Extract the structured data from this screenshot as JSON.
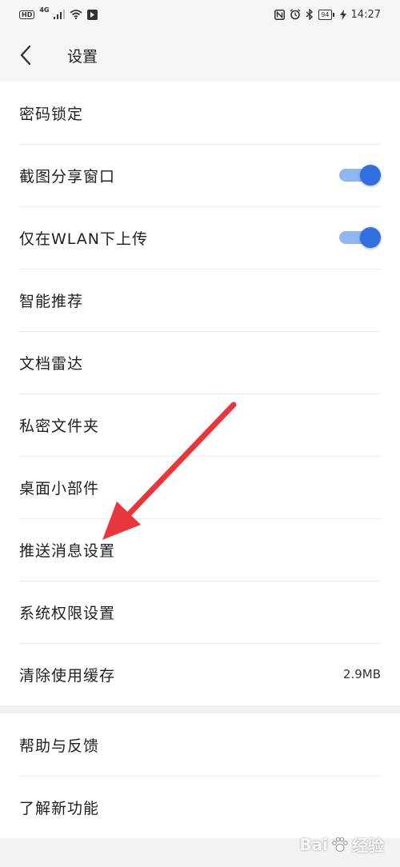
{
  "status_bar": {
    "hd_label": "HD",
    "network_label": "4G",
    "battery_level": "94",
    "time": "14:27"
  },
  "header": {
    "title": "设置",
    "back_icon": "chevron-left-icon"
  },
  "settings": {
    "group1": [
      {
        "label": "密码锁定"
      },
      {
        "label": "截图分享窗口",
        "toggle": true
      },
      {
        "label": "仅在WLAN下上传",
        "toggle": true
      },
      {
        "label": "智能推荐"
      },
      {
        "label": "文档雷达"
      },
      {
        "label": "私密文件夹"
      },
      {
        "label": "桌面小部件"
      },
      {
        "label": "推送消息设置"
      },
      {
        "label": "系统权限设置"
      },
      {
        "label": "清除使用缓存",
        "value": "2.9MB"
      }
    ],
    "group2": [
      {
        "label": "帮助与反馈"
      },
      {
        "label": "了解新功能"
      }
    ]
  },
  "colors": {
    "toggle_on": "#2f6fe0",
    "toggle_track": "#8fb6f0",
    "arrow": "#e8363a"
  },
  "watermark": {
    "brand": "Bai",
    "suffix": "经验"
  }
}
